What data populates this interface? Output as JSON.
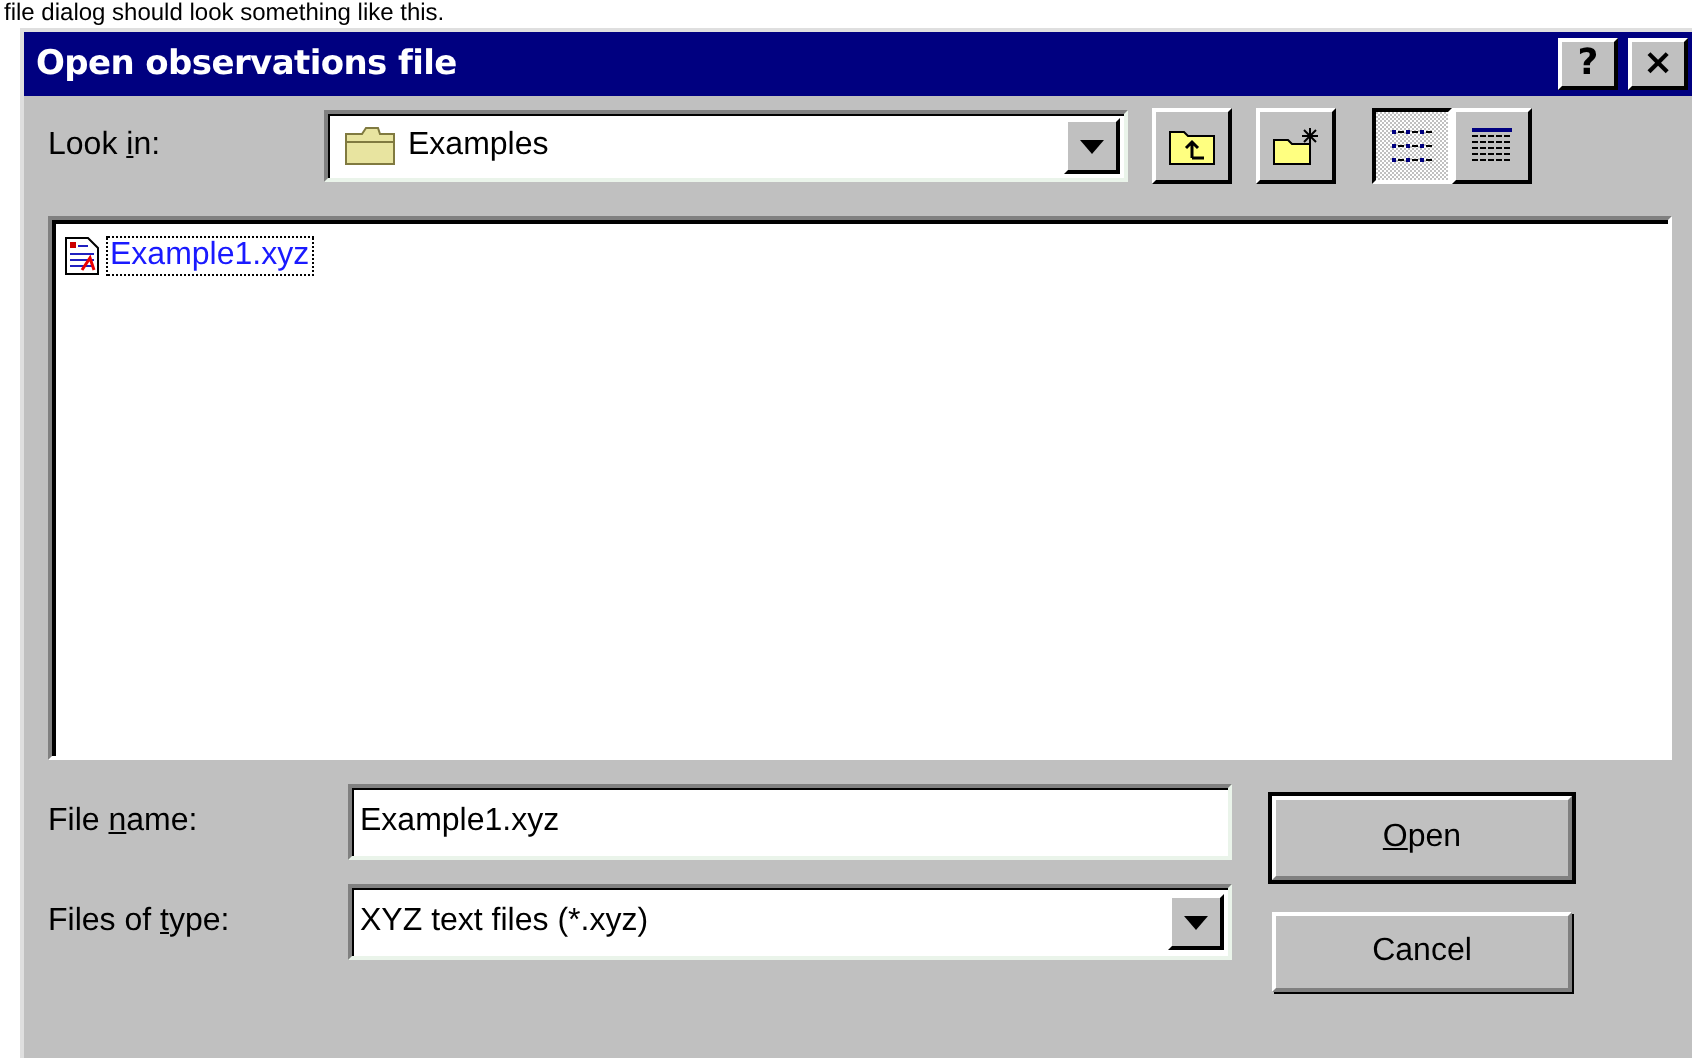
{
  "caption": "file dialog should look something like this.",
  "window": {
    "title": "Open observations file",
    "buttons": [
      {
        "kind": "help",
        "label": "?"
      },
      {
        "kind": "close",
        "label": "×"
      }
    ]
  },
  "look_in": {
    "label": {
      "pre": "Look ",
      "key": "i",
      "post": "n:"
    },
    "value": "Examples"
  },
  "toolbar": [
    {
      "kind": "up",
      "selected": false
    },
    {
      "kind": "new-folder",
      "selected": false
    },
    {
      "kind": "list",
      "selected": true
    },
    {
      "kind": "details",
      "selected": false
    }
  ],
  "files": [
    {
      "name": "Example1.xyz",
      "selected": true
    }
  ],
  "fields": [
    {
      "kind": "text",
      "label": {
        "pre": "File ",
        "key": "n",
        "post": "ame:"
      },
      "value": "Example1.xyz"
    },
    {
      "kind": "dropdown",
      "label": {
        "pre": "Files of ",
        "key": "t",
        "post": "ype:"
      },
      "value": "XYZ text files (*.xyz)"
    }
  ],
  "buttons": [
    {
      "label": {
        "key": "O",
        "post": "pen"
      },
      "default": true
    },
    {
      "label": {
        "post": "Cancel"
      },
      "default": false
    }
  ]
}
